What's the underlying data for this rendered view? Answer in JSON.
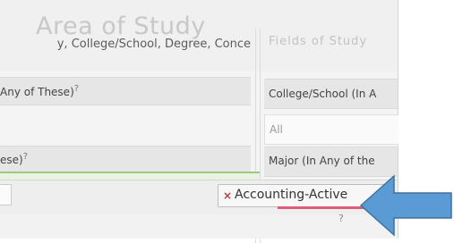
{
  "filter_panel": {
    "area_title": "Area of Study",
    "area_subtitle": "y, College/School, Degree, Conce",
    "right_header_blurred": "Fields of Study"
  },
  "left_column": {
    "field1_label": "Any of These)",
    "field1_help": "?",
    "field2_label": "ese)",
    "field2_help": "?"
  },
  "right_column": {
    "college_label": "College/School (In A",
    "college_value": "All",
    "major_label": "Major (In Any of the",
    "bottom_help": "?"
  },
  "selected_tag": {
    "remove_symbol": "×",
    "text": "Accounting-Active"
  },
  "colors": {
    "arrow_fill": "#5b9bd5",
    "arrow_stroke": "#41719c",
    "tag_underline": "#e25a7a",
    "focus_border": "#9cc97a"
  }
}
